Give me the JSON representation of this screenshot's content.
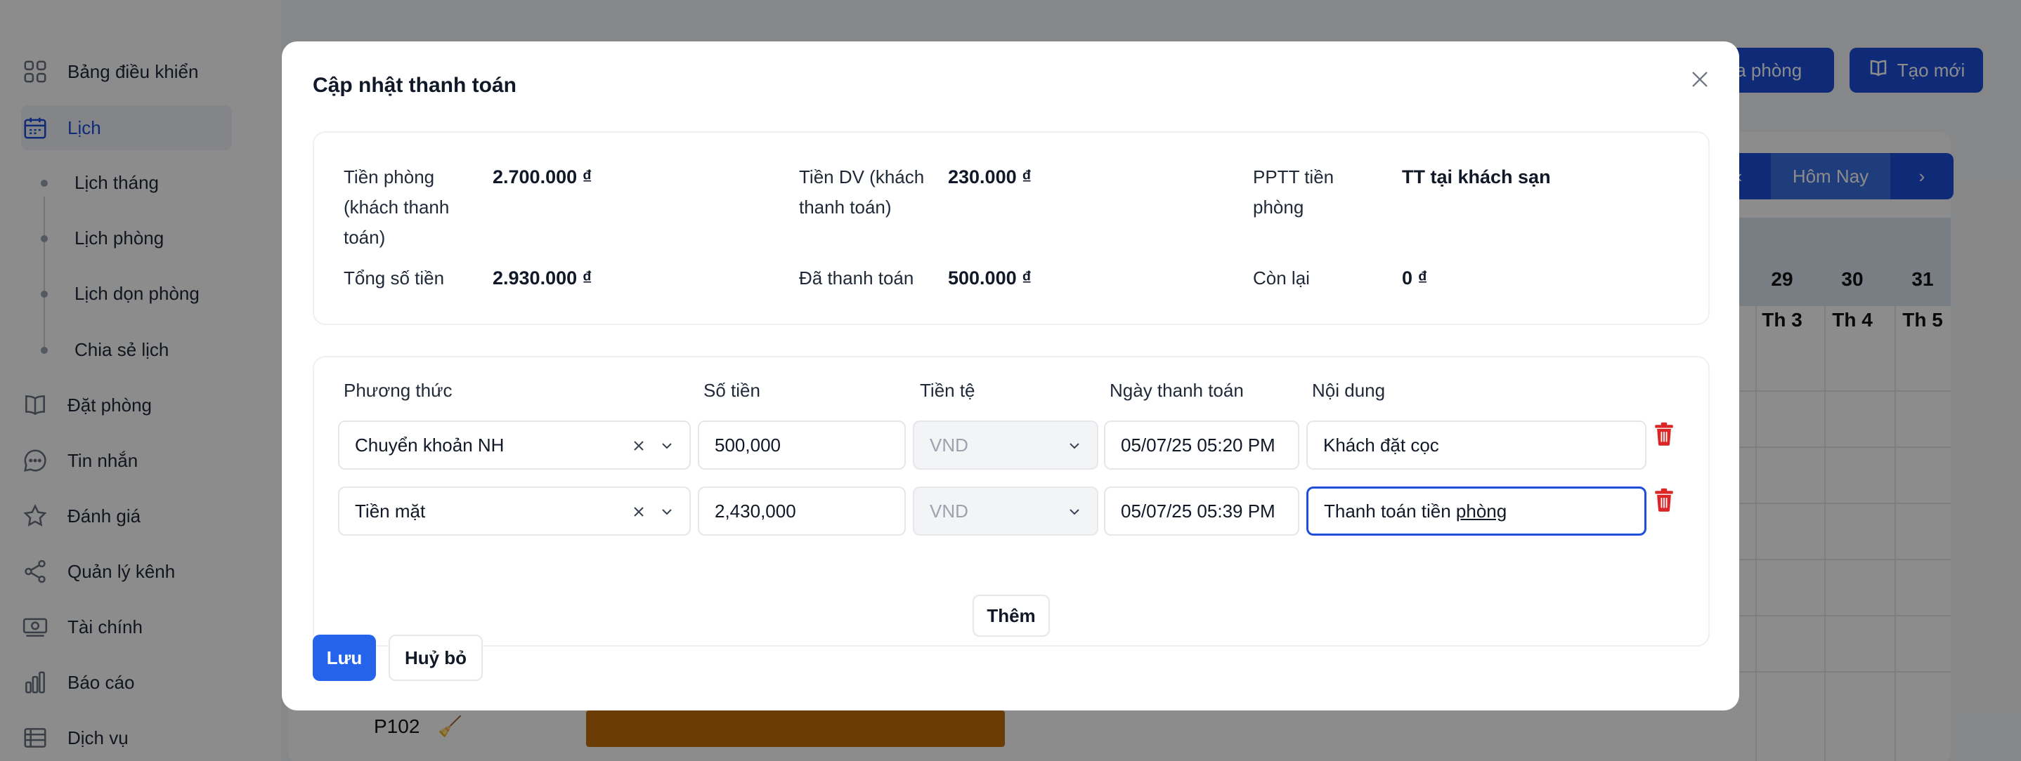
{
  "sidebar": {
    "items": [
      {
        "label": "Bảng điều khiển",
        "icon": "dashboard-icon"
      },
      {
        "label": "Lịch",
        "icon": "calendar-icon",
        "active": true
      },
      {
        "label": "Đặt phòng",
        "icon": "book-icon"
      },
      {
        "label": "Tin nhắn",
        "icon": "chat-icon"
      },
      {
        "label": "Đánh giá",
        "icon": "star-icon"
      },
      {
        "label": "Quản lý kênh",
        "icon": "share-icon"
      },
      {
        "label": "Tài chính",
        "icon": "money-icon"
      },
      {
        "label": "Báo cáo",
        "icon": "chart-icon"
      },
      {
        "label": "Dịch vụ",
        "icon": "list-icon"
      }
    ],
    "calendar_subitems": [
      "Lịch tháng",
      "Lịch phòng",
      "Lịch dọn phòng",
      "Chia sẻ lịch"
    ]
  },
  "header": {
    "lock_room_label": "óa phòng",
    "create_new_label": "Tạo mới"
  },
  "calendar": {
    "today_label": "Hôm Nay",
    "prev_label": "‹",
    "next_label": "›",
    "days": [
      {
        "date": "29",
        "weekday": "Th 3"
      },
      {
        "date": "30",
        "weekday": "Th 4"
      },
      {
        "date": "31",
        "weekday": "Th 5"
      }
    ],
    "room_label": "P102",
    "room_status_icon": "🧹"
  },
  "modal": {
    "title": "Cập nhật thanh toán",
    "summary": {
      "room_paid_label": "Tiền phòng (khách thanh toán)",
      "room_paid_value": "2.700.000 ₫",
      "service_paid_label": "Tiền DV (khách thanh toán)",
      "service_paid_value": "230.000 ₫",
      "room_method_label": "PPTT tiền phòng",
      "room_method_value": "TT tại khách sạn",
      "total_label": "Tổng số tiền",
      "total_value": "2.930.000 ₫",
      "paid_label": "Đã thanh toán",
      "paid_value": "500.000 ₫",
      "remaining_label": "Còn lại",
      "remaining_value": "0 ₫"
    },
    "columns": {
      "method": "Phương thức",
      "amount": "Số tiền",
      "currency": "Tiền tệ",
      "date": "Ngày thanh toán",
      "content": "Nội dung"
    },
    "rows": [
      {
        "method": "Chuyển khoản NH",
        "amount": "500,000",
        "currency": "VND",
        "date": "05/07/25 05:20 PM",
        "content": "Khách đặt cọc"
      },
      {
        "method": "Tiền mặt",
        "amount": "2,430,000",
        "currency": "VND",
        "date": "05/07/25 05:39 PM",
        "content_main": "Thanh toán tiền ",
        "content_underlined": "phòng"
      }
    ],
    "add_label": "Thêm",
    "save_label": "Lưu",
    "cancel_label": "Huỷ bỏ"
  },
  "colors": {
    "primary": "#2563eb",
    "danger": "#dc2626",
    "booking_bar": "#c2700c"
  }
}
